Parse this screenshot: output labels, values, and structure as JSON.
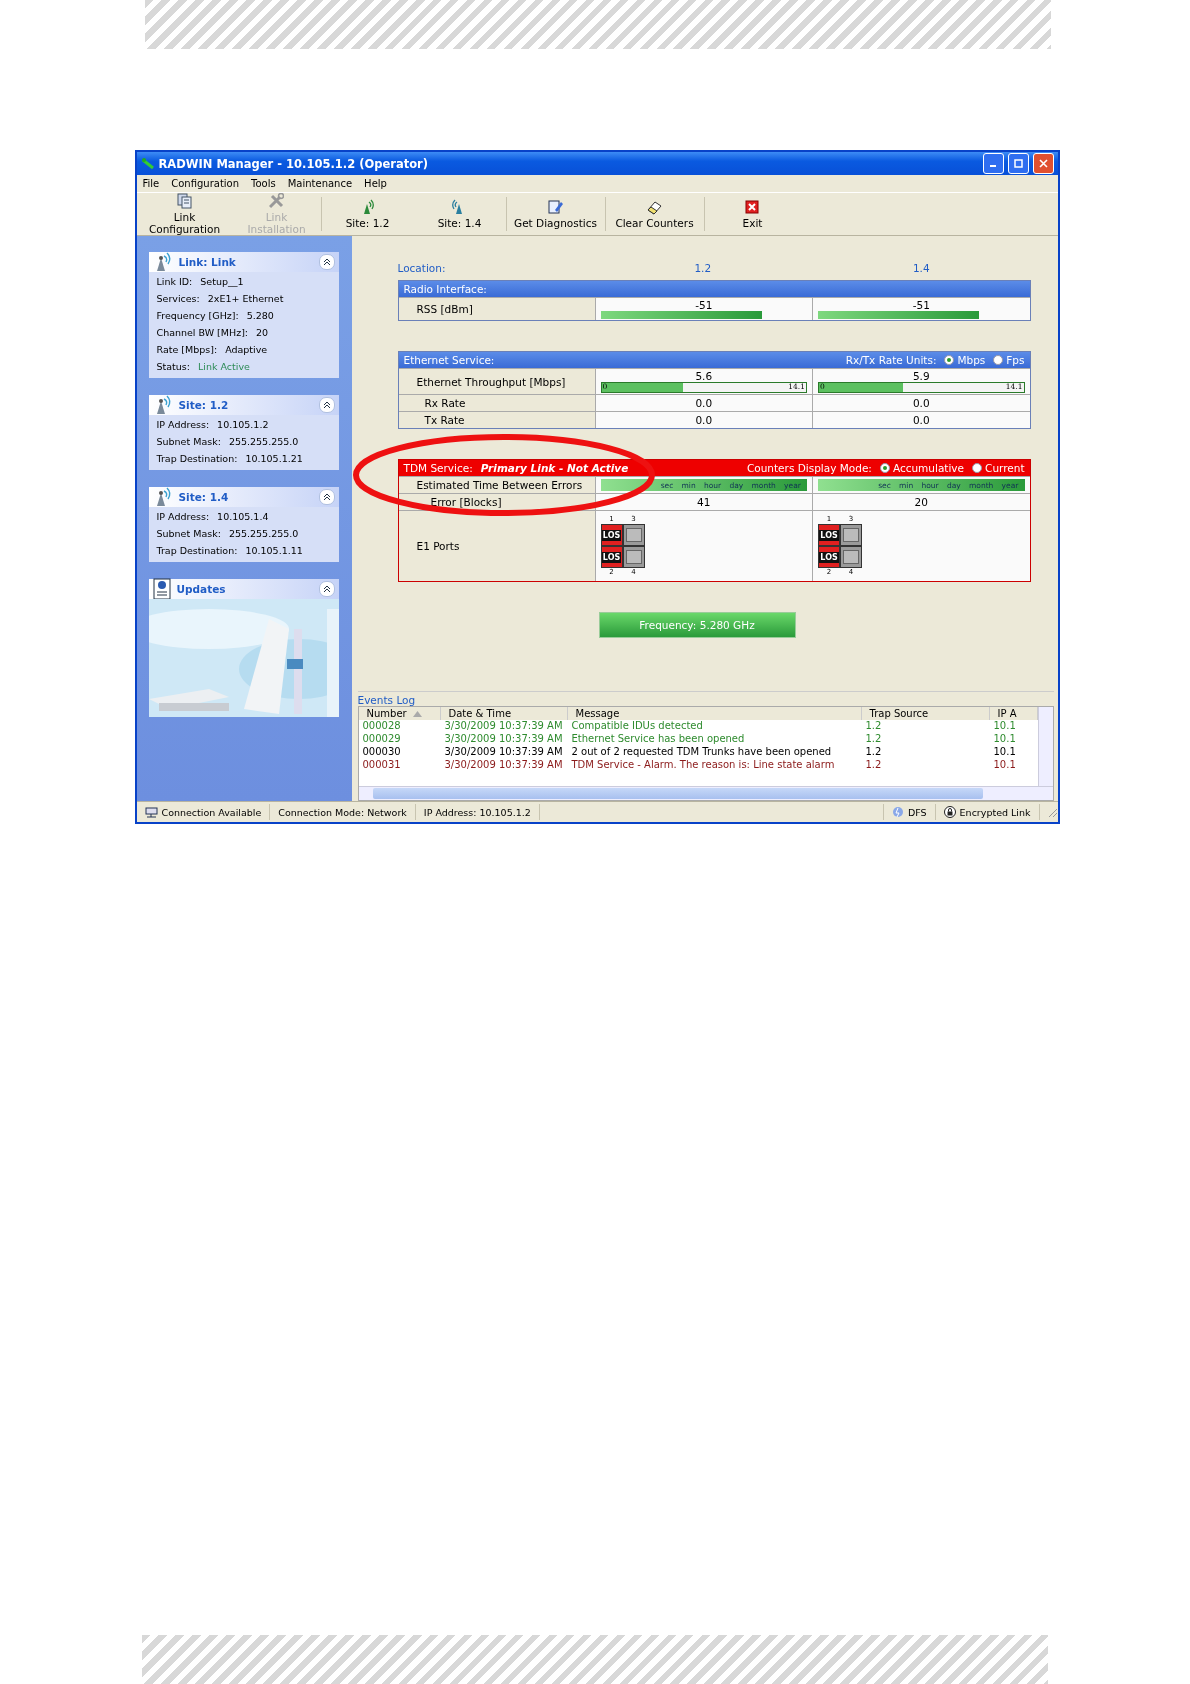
{
  "window": {
    "title": "RADWIN Manager - 10.105.1.2 (Operator)"
  },
  "menu": [
    "File",
    "Configuration",
    "Tools",
    "Maintenance",
    "Help"
  ],
  "toolbar": [
    {
      "label": "Link Configuration",
      "disabled": false
    },
    {
      "label": "Link Installation",
      "disabled": true
    },
    {
      "label": "Site: 1.2",
      "disabled": false
    },
    {
      "label": "Site: 1.4",
      "disabled": false
    },
    {
      "label": "Get Diagnostics",
      "disabled": false
    },
    {
      "label": "Clear Counters",
      "disabled": false
    },
    {
      "label": "Exit",
      "disabled": false
    }
  ],
  "sidebar": [
    {
      "title": "Link: Link",
      "fields": [
        {
          "label": "Link ID:",
          "value": "Setup__1"
        },
        {
          "label": "Services:",
          "value": "2xE1+ Ethernet"
        },
        {
          "label": "Frequency [GHz]:",
          "value": "5.280"
        },
        {
          "label": "Channel BW [MHz]:",
          "value": "20"
        },
        {
          "label": "Rate [Mbps]:",
          "value": "Adaptive"
        },
        {
          "label": "Status:",
          "value": "Link Active",
          "kind": "status"
        }
      ]
    },
    {
      "title": "Site: 1.2",
      "fields": [
        {
          "label": "IP Address:",
          "value": "10.105.1.2"
        },
        {
          "label": "Subnet Mask:",
          "value": "255.255.255.0"
        },
        {
          "label": "Trap Destination:",
          "value": "10.105.1.21"
        }
      ]
    },
    {
      "title": "Site: 1.4",
      "fields": [
        {
          "label": "IP Address:",
          "value": "10.105.1.4"
        },
        {
          "label": "Subnet Mask:",
          "value": "255.255.255.0"
        },
        {
          "label": "Trap Destination:",
          "value": "10.105.1.11"
        }
      ]
    },
    {
      "title": "Updates",
      "kind": "picture"
    }
  ],
  "location": {
    "label": "Location:",
    "sites": [
      "1.2",
      "1.4"
    ]
  },
  "radio": {
    "title": "Radio Interface:",
    "rows": [
      {
        "label": "RSS [dBm]",
        "values": [
          {
            "reading": "-51",
            "level": 0.78
          },
          {
            "reading": "-51",
            "level": 0.78
          }
        ]
      }
    ]
  },
  "ethernet": {
    "title": "Ethernet Service:",
    "units_label": "Rx/Tx Rate Units:",
    "units": [
      {
        "label": "Mbps",
        "selected": true
      },
      {
        "label": "Fps",
        "selected": false
      }
    ],
    "throughput": {
      "label": "Ethernet Throughput [Mbps]",
      "values": [
        {
          "reading": "5.6",
          "level": 0.4,
          "min": "0",
          "max": "14.1"
        },
        {
          "reading": "5.9",
          "level": 0.41,
          "min": "0",
          "max": "14.1"
        }
      ]
    },
    "rows": [
      {
        "label": "Rx Rate",
        "values": [
          "0.0",
          "0.0"
        ]
      },
      {
        "label": "Tx Rate",
        "values": [
          "0.0",
          "0.0"
        ]
      }
    ]
  },
  "tdm": {
    "title": "TDM Service:",
    "status": "Primary Link - Not Active",
    "counters_label": "Counters Display Mode:",
    "modes": [
      {
        "label": "Accumulative",
        "selected": true
      },
      {
        "label": "Current",
        "selected": false
      }
    ],
    "etbe": {
      "label": "Estimated Time Between Errors",
      "scales": [
        [
          "sec",
          "min",
          "hour",
          "day",
          "month",
          "year"
        ],
        [
          "sec",
          "min",
          "hour",
          "day",
          "month",
          "year"
        ]
      ]
    },
    "errors": {
      "label": "Error [Blocks]",
      "values": [
        "41",
        "20"
      ]
    },
    "ports_label": "E1 Ports",
    "ports": [
      [
        {
          "number": "1",
          "alarm": true,
          "label": "LOS"
        },
        {
          "number": "2",
          "alarm": true,
          "label": "LOS"
        },
        {
          "number": "3",
          "alarm": false
        },
        {
          "number": "4",
          "alarm": false
        }
      ],
      [
        {
          "number": "1",
          "alarm": true,
          "label": "LOS"
        },
        {
          "number": "2",
          "alarm": true,
          "label": "LOS"
        },
        {
          "number": "3",
          "alarm": false
        },
        {
          "number": "4",
          "alarm": false
        }
      ]
    ]
  },
  "frequency_button": "Frequency: 5.280 GHz",
  "events": {
    "title": "Events Log",
    "columns": [
      {
        "label": "Number",
        "sorted": true
      },
      {
        "label": "Date & Time",
        "sorted": false
      },
      {
        "label": "Message",
        "sorted": false
      },
      {
        "label": "Trap Source",
        "sorted": false
      },
      {
        "label": "IP A",
        "sorted": false
      }
    ],
    "rows": [
      {
        "cells": [
          "000028",
          "3/30/2009 10:37:39 AM",
          "Compatible IDUs detected",
          "1.2",
          "10.1"
        ],
        "color": "#2e8b2e"
      },
      {
        "cells": [
          "000029",
          "3/30/2009 10:37:39 AM",
          "Ethernet Service has been opened",
          "1.2",
          "10.1"
        ],
        "color": "#2e8b2e"
      },
      {
        "cells": [
          "000030",
          "3/30/2009 10:37:39 AM",
          "2 out of 2 requested TDM Trunks have been opened",
          "1.2",
          "10.1"
        ],
        "color": "#000000"
      },
      {
        "cells": [
          "000031",
          "3/30/2009 10:37:39 AM",
          "TDM Service - Alarm. The reason is: Line state alarm",
          "1.2",
          "10.1"
        ],
        "color": "#8b1a1a"
      }
    ]
  },
  "status_bar": [
    {
      "text": "Connection Available",
      "kind": "connection"
    },
    {
      "text": "Connection Mode: Network",
      "kind": "plain"
    },
    {
      "text": "IP Address: 10.105.1.2",
      "kind": "plain"
    },
    {
      "text": "DFS",
      "kind": "dfs"
    },
    {
      "text": "Encrypted Link",
      "kind": "lock"
    }
  ]
}
